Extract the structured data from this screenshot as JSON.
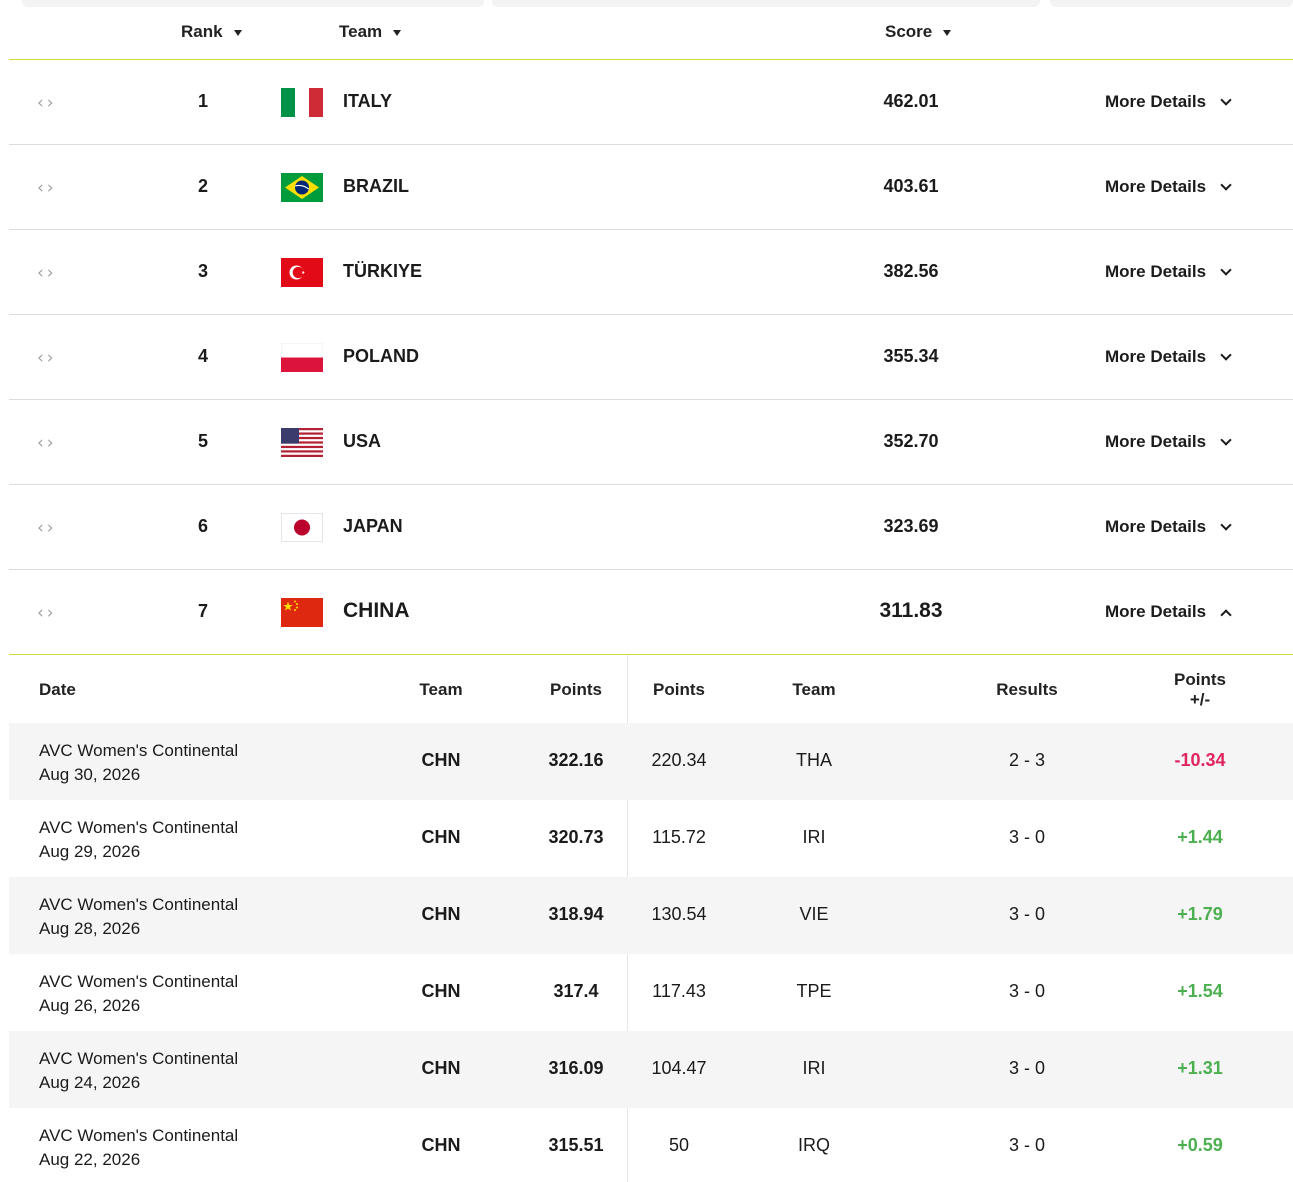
{
  "header": {
    "rank_label": "Rank",
    "team_label": "Team",
    "score_label": "Score"
  },
  "rankings": [
    {
      "rank": "1",
      "team": "ITALY",
      "flag": "italy-flag",
      "score": "462.01",
      "more": "More Details"
    },
    {
      "rank": "2",
      "team": "BRAZIL",
      "flag": "brazil-flag",
      "score": "403.61",
      "more": "More Details"
    },
    {
      "rank": "3",
      "team": "TÜRKIYE",
      "flag": "turkiye-flag",
      "score": "382.56",
      "more": "More Details"
    },
    {
      "rank": "4",
      "team": "POLAND",
      "flag": "poland-flag",
      "score": "355.34",
      "more": "More Details"
    },
    {
      "rank": "5",
      "team": "USA",
      "flag": "usa-flag",
      "score": "352.70",
      "more": "More Details"
    },
    {
      "rank": "6",
      "team": "JAPAN",
      "flag": "japan-flag",
      "score": "323.69",
      "more": "More Details"
    },
    {
      "rank": "7",
      "team": "CHINA",
      "flag": "china-flag",
      "score": "311.83",
      "more": "More Details"
    }
  ],
  "expanded_rank": "7",
  "details": {
    "headers": {
      "date": "Date",
      "team": "Team",
      "points": "Points",
      "opp_points": "Points",
      "opp_team": "Team",
      "results": "Results",
      "delta_line1": "Points",
      "delta_line2": "+/-"
    },
    "rows": [
      {
        "event": "AVC Women's Continental",
        "date": "Aug 30, 2026",
        "team": "CHN",
        "points": "322.16",
        "opp_points": "220.34",
        "opp_team": "THA",
        "result": "2 - 3",
        "delta": "-10.34",
        "delta_sign": "negative"
      },
      {
        "event": "AVC Women's Continental",
        "date": "Aug 29, 2026",
        "team": "CHN",
        "points": "320.73",
        "opp_points": "115.72",
        "opp_team": "IRI",
        "result": "3 - 0",
        "delta": "+1.44",
        "delta_sign": "positive"
      },
      {
        "event": "AVC Women's Continental",
        "date": "Aug 28, 2026",
        "team": "CHN",
        "points": "318.94",
        "opp_points": "130.54",
        "opp_team": "VIE",
        "result": "3 - 0",
        "delta": "+1.79",
        "delta_sign": "positive"
      },
      {
        "event": "AVC Women's Continental",
        "date": "Aug 26, 2026",
        "team": "CHN",
        "points": "317.4",
        "opp_points": "117.43",
        "opp_team": "TPE",
        "result": "3 - 0",
        "delta": "+1.54",
        "delta_sign": "positive"
      },
      {
        "event": "AVC Women's Continental",
        "date": "Aug 24, 2026",
        "team": "CHN",
        "points": "316.09",
        "opp_points": "104.47",
        "opp_team": "IRI",
        "result": "3 - 0",
        "delta": "+1.31",
        "delta_sign": "positive"
      },
      {
        "event": "AVC Women's Continental",
        "date": "Aug 22, 2026",
        "team": "CHN",
        "points": "315.51",
        "opp_points": "50",
        "opp_team": "IRQ",
        "result": "3 - 0",
        "delta": "+0.59",
        "delta_sign": "positive"
      }
    ]
  },
  "colors": {
    "accent_line": "#cddc39",
    "negative": "#e0245e",
    "positive": "#4caf50",
    "row_shade": "#f5f5f5"
  }
}
